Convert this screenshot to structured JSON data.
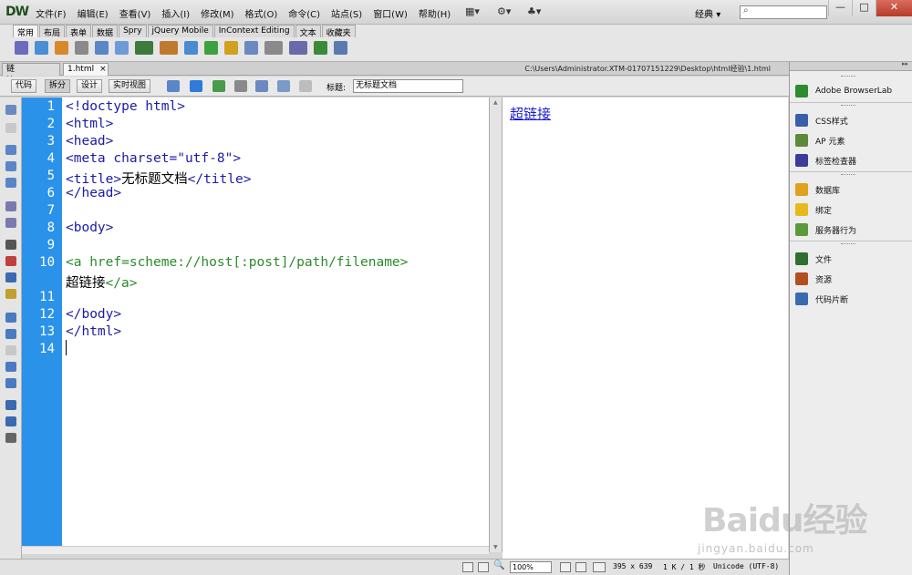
{
  "app": {
    "logo": "DW",
    "menu": [
      "文件(F)",
      "编辑(E)",
      "查看(V)",
      "插入(I)",
      "修改(M)",
      "格式(O)",
      "命令(C)",
      "站点(S)",
      "窗口(W)",
      "帮助(H)"
    ],
    "workspace": "经典",
    "workspace_arrow": "▾",
    "search_placeholder": "",
    "window_buttons": {
      "minimize": "—",
      "restore": "□",
      "close": "✕"
    }
  },
  "insert_bar": {
    "tabs": [
      "常用",
      "布局",
      "表单",
      "数据",
      "Spry",
      "jQuery Mobile",
      "InContext Editing",
      "文本",
      "收藏夹"
    ],
    "active_tab": "常用"
  },
  "documents": {
    "tabs": [
      {
        "label": "链接.html*",
        "close": "×"
      },
      {
        "label": "1.html",
        "close": "×"
      }
    ],
    "path": "C:\\Users\\Administrator.XTM-01707151229\\Desktop\\html经验\\1.html"
  },
  "doc_toolbar": {
    "views": [
      "代码",
      "拆分",
      "设计",
      "实时视图"
    ],
    "active_view": "拆分",
    "title_label": "标题:",
    "title_value": "无标题文档"
  },
  "code": {
    "lines": [
      {
        "num": "1",
        "code": "<!doctype html>",
        "color": "#1b1ba6"
      },
      {
        "num": "2",
        "code": "<html>",
        "color": "#1b1ba6"
      },
      {
        "num": "3",
        "code": "<head>",
        "color": "#1b1ba6"
      },
      {
        "num": "4",
        "code": "<meta charset=\"utf-8\">",
        "color": "#1b1ba6"
      },
      {
        "num": "5",
        "pre": "<title>",
        "text": "无标题文档",
        "post": "</title>",
        "color": "#1b1ba6"
      },
      {
        "num": "6",
        "code": "</head>",
        "color": "#1b1ba6"
      },
      {
        "num": "7",
        "code": "",
        "color": "#1b1ba6"
      },
      {
        "num": "8",
        "code": "<body>",
        "color": "#1b1ba6"
      },
      {
        "num": "9",
        "code": "",
        "color": "#1b1ba6"
      },
      {
        "num": "10",
        "code": "<a href=scheme://host[:post]/path/filename>",
        "color": "#2b8a2b"
      },
      {
        "num": "",
        "pre": "",
        "text": "超链接",
        "post": "</a>",
        "color": "#2b8a2b"
      },
      {
        "num": "11",
        "code": "",
        "color": "#1b1ba6"
      },
      {
        "num": "12",
        "code": "</body>",
        "color": "#1b1ba6"
      },
      {
        "num": "13",
        "code": "</html>",
        "color": "#1b1ba6"
      },
      {
        "num": "14",
        "code": "",
        "color": "#1b1ba6"
      }
    ],
    "gutter_color": "#2b92ea"
  },
  "design": {
    "link_text": "超链接"
  },
  "status_bar": {
    "zoom": "100%",
    "dimensions": "395 x 639",
    "size_time": "1 K / 1 秒",
    "encoding": "Unicode (UTF-8)"
  },
  "right_panel": {
    "groups": [
      [
        {
          "label": "Adobe BrowserLab",
          "icon": "browserlab-icon",
          "color": "#2e8b2e"
        }
      ],
      [
        {
          "label": "CSS样式",
          "icon": "css-styles-icon",
          "color": "#3a5fa8"
        },
        {
          "label": "AP 元素",
          "icon": "ap-elements-icon",
          "color": "#5b8a3a"
        },
        {
          "label": "标签检查器",
          "icon": "tag-inspector-icon",
          "color": "#3b3b9a"
        }
      ],
      [
        {
          "label": "数据库",
          "icon": "database-icon",
          "color": "#e0a020"
        },
        {
          "label": "绑定",
          "icon": "bindings-icon",
          "color": "#e8b820"
        },
        {
          "label": "服务器行为",
          "icon": "server-behaviors-icon",
          "color": "#5a9a3a"
        }
      ],
      [
        {
          "label": "文件",
          "icon": "files-icon",
          "color": "#2f6f2f"
        },
        {
          "label": "资源",
          "icon": "assets-icon",
          "color": "#b05020"
        },
        {
          "label": "代码片断",
          "icon": "snippets-icon",
          "color": "#3a6ab0"
        }
      ]
    ]
  },
  "watermark": {
    "brand": "Baidu经验",
    "url": "jingyan.baidu.com"
  }
}
